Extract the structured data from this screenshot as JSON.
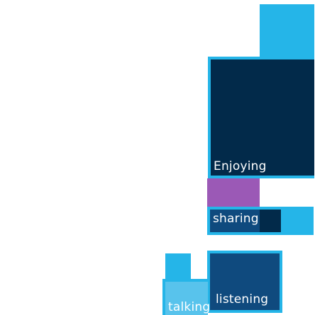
{
  "words": {
    "enjoying": "Enjoying",
    "sharing": "sharing",
    "listening": "listening",
    "talking": "talking"
  },
  "colors": {
    "cyan": "#25b5e8",
    "light_blue_fill": "#58c3ec",
    "dark_navy": "#022a4a",
    "purple": "#9b59b6",
    "mid_blue": "#0f4a7e",
    "white": "#ffffff"
  }
}
